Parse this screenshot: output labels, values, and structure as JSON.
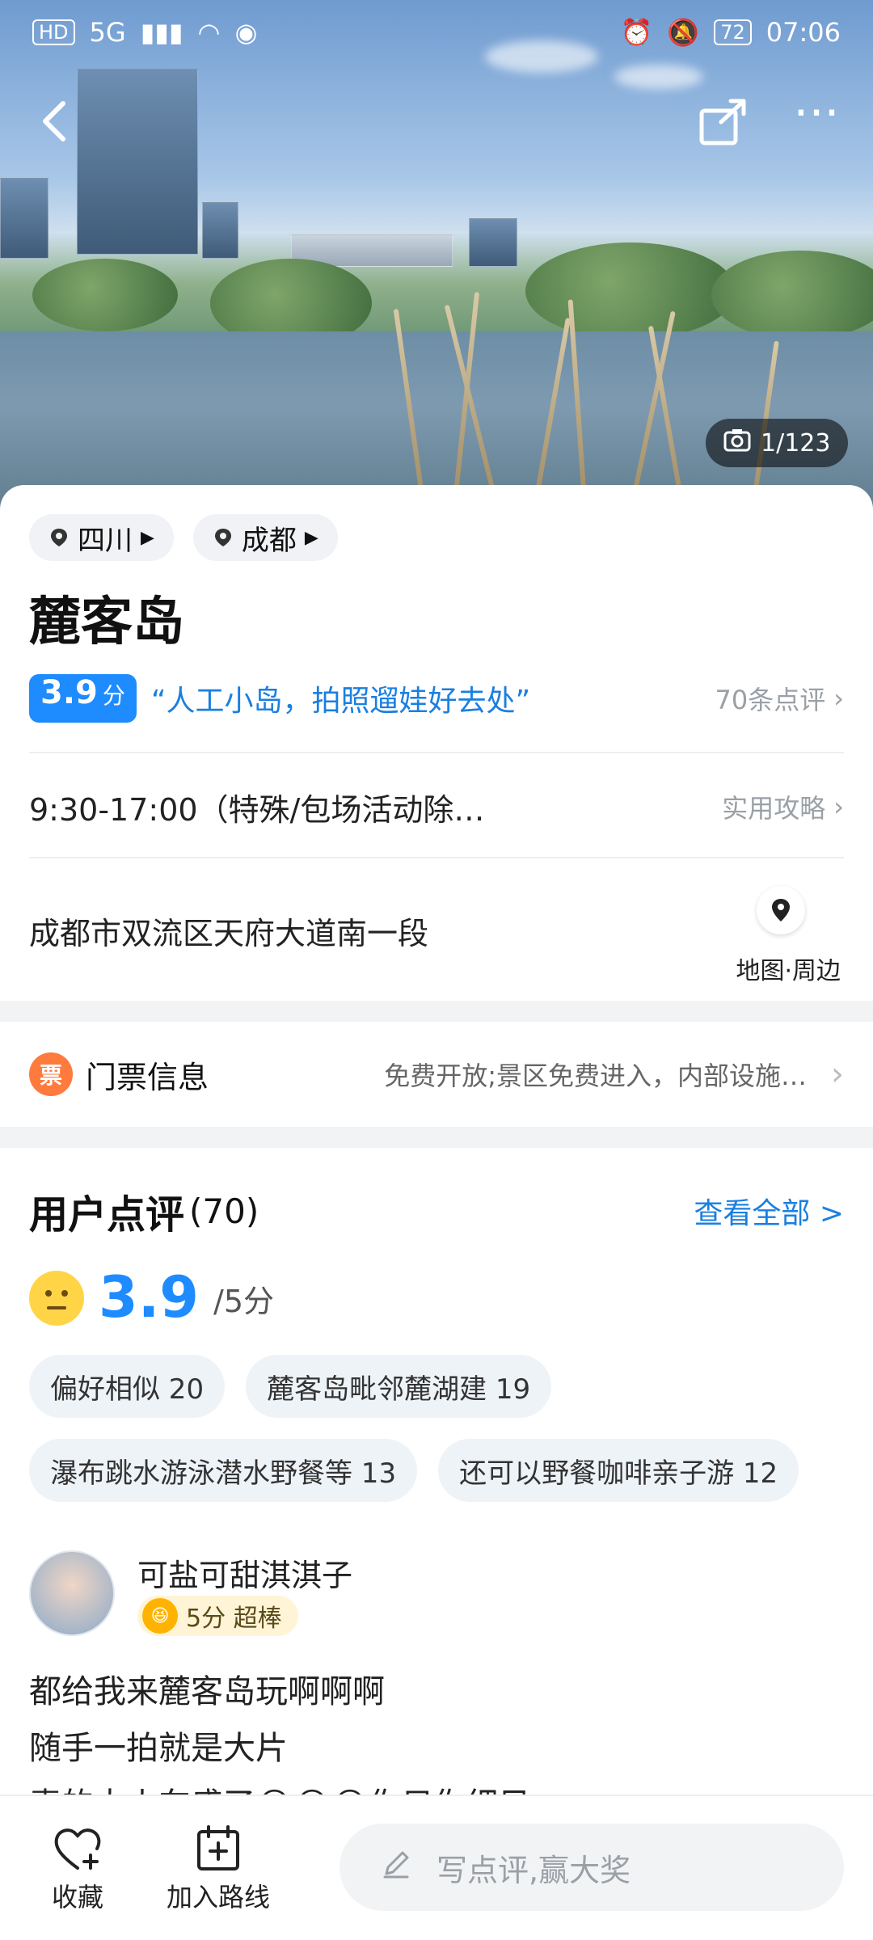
{
  "status_bar": {
    "left_badges": [
      "HD",
      "5G"
    ],
    "battery": "72",
    "time": "07:06"
  },
  "nav": {
    "back_icon": "chevron-left-icon",
    "share_icon": "share-icon",
    "more_icon": "more-icon"
  },
  "photo_counter": "1/123",
  "location_chips": [
    {
      "label": "四川"
    },
    {
      "label": "成都"
    }
  ],
  "title": "麓客岛",
  "rating": {
    "score": "3.9",
    "unit": "分",
    "quote": "“人工小岛，拍照遛娃好去处”",
    "reviews_link": "70条点评"
  },
  "hours": {
    "text": "9:30-17:00（特殊/包场活动除…",
    "guide_link": "实用攻略"
  },
  "address": {
    "text": "成都市双流区天府大道南一段",
    "map_label": "地图·周边"
  },
  "ticket": {
    "icon_text": "票",
    "label": "门票信息",
    "value": "免费开放;景区免费进入，内部设施…"
  },
  "reviews": {
    "title": "用户点评",
    "count": "(70)",
    "see_all": "查看全部 >",
    "score": "3.9",
    "denom": "/5分",
    "tags": [
      "偏好相似 20",
      "麓客岛毗邻麓湖建 19",
      "瀑布跳水游泳潜水野餐等 13",
      "还可以野餐咖啡亲子游 12"
    ],
    "first": {
      "user": "可盐可甜淇淇子",
      "badge": "5分 超棒",
      "lines": [
        "都给我来麓客岛玩啊啊啊",
        "随手一拍就是大片",
        "素的太火车盛了😂😂😂你只你细目"
      ]
    }
  },
  "bottom_bar": {
    "favorite": "收藏",
    "add_route": "加入路线",
    "write_review": "写点评,赢大奖"
  },
  "colors": {
    "accent": "#1e8bff",
    "quote": "#1a7fe0",
    "ticket": "#ff7a3d"
  }
}
